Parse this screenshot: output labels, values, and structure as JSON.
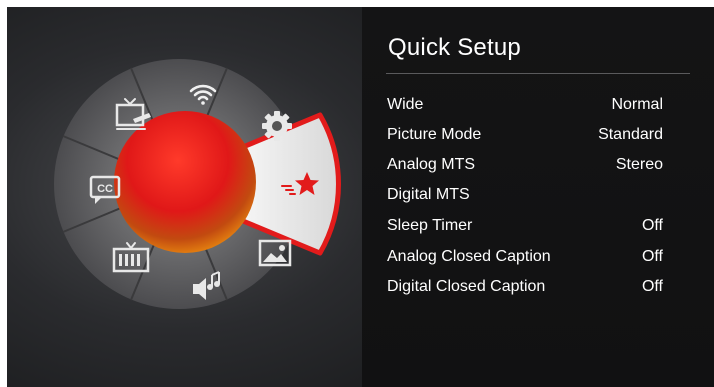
{
  "menu": {
    "title": "Quick Setup",
    "items": [
      {
        "label": "Wide",
        "value": "Normal"
      },
      {
        "label": "Picture Mode",
        "value": "Standard"
      },
      {
        "label": "Analog MTS",
        "value": "Stereo"
      },
      {
        "label": "Digital MTS",
        "value": ""
      },
      {
        "label": "Sleep Timer",
        "value": "Off"
      },
      {
        "label": "Analog Closed Caption",
        "value": "Off"
      },
      {
        "label": "Digital Closed Caption",
        "value": "Off"
      }
    ]
  },
  "wheel": {
    "segments": [
      {
        "icon": "wifi-icon",
        "name": "network"
      },
      {
        "icon": "gear-icon",
        "name": "settings"
      },
      {
        "icon": "star-icon",
        "name": "quick-setup",
        "selected": true
      },
      {
        "icon": "picture-icon",
        "name": "picture"
      },
      {
        "icon": "audio-icon",
        "name": "audio"
      },
      {
        "icon": "tv-icon",
        "name": "channels"
      },
      {
        "icon": "cc-icon",
        "name": "closed-caption"
      },
      {
        "icon": "tv-input-icon",
        "name": "input"
      }
    ],
    "cc_text": "CC",
    "selected_color": "#e21b1b",
    "orb_color": "#d91e1e"
  }
}
